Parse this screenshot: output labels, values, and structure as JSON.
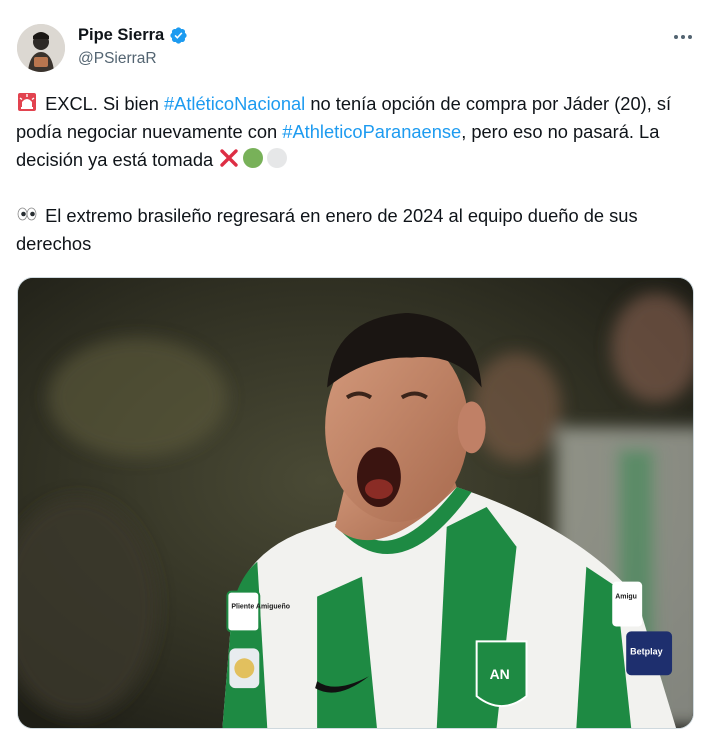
{
  "author": {
    "display_name": "Pipe Sierra",
    "handle": "@PSierraR",
    "verified": true,
    "avatar_icon": "profile-photo",
    "verified_icon": "verified-badge-icon"
  },
  "menu_icon": "more-options-icon",
  "tweet": {
    "line1_icon": "siren-emoji",
    "part1": " EXCL. Si bien ",
    "hashtag1": "#AtléticoNacional",
    "part2": " no tenía opción de compra por Jáder (20), sí podía negociar nuevamente con ",
    "hashtag2": "#AthleticoParanaense",
    "part3": ", pero eso no pasará. La decisión ya está tomada ",
    "end_icons": [
      "cross-mark-emoji",
      "green-circle-emoji",
      "white-circle-emoji"
    ],
    "line2_icon": "eyes-emoji",
    "paragraph2": " El extremo brasileño regresará en enero de 2024 al equipo dueño de sus derechos"
  },
  "media": {
    "type": "photo",
    "icon": "player-celebration-photo",
    "visible_texts": [
      "Pliente Amigueño",
      "Amigu",
      "Betplay",
      "AN"
    ]
  },
  "colors": {
    "link": "#1d9bf0",
    "verified": "#1d9bf0",
    "text": "#0f1419",
    "secondary": "#536471",
    "jersey_green": "#1e8a43"
  }
}
